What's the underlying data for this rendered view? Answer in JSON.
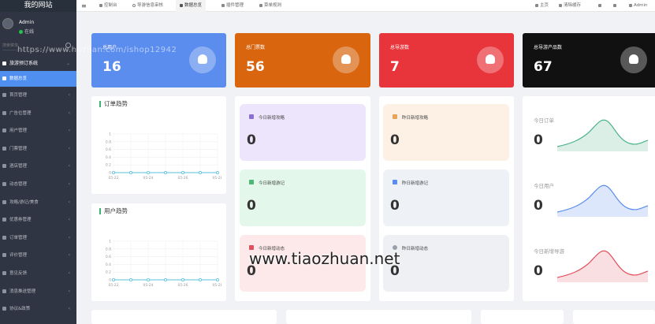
{
  "brand": "我的网站",
  "user": {
    "name": "Admin",
    "status": "在线"
  },
  "search": {
    "placeholder": "搜索菜单"
  },
  "sidebar": {
    "group": "旅游预订系统",
    "items": [
      {
        "label": "数据总览",
        "active": true
      },
      {
        "label": "首页管理"
      },
      {
        "label": "广告位管理"
      },
      {
        "label": "用户管理"
      },
      {
        "label": "门票管理"
      },
      {
        "label": "酒店管理"
      },
      {
        "label": "动态管理"
      },
      {
        "label": "攻略/游记/美食"
      },
      {
        "label": "优惠券管理"
      },
      {
        "label": "订单管理"
      },
      {
        "label": "评价管理"
      },
      {
        "label": "意见反馈"
      },
      {
        "label": "消息推送管理"
      },
      {
        "label": "协议&政策"
      }
    ]
  },
  "topbar": {
    "menu_icon": "≡",
    "tabs": [
      {
        "label": "控制台"
      },
      {
        "label": "导游信息审核"
      },
      {
        "label": "数据总览",
        "active": true
      },
      {
        "label": "插件管理"
      },
      {
        "label": "菜单规则"
      }
    ],
    "right": {
      "home": "主页",
      "clear_cache": "清除缓存",
      "user": "Admin"
    }
  },
  "stats": [
    {
      "label": "总用户",
      "value": "16",
      "color": "#5b8def",
      "icon": "user-icon"
    },
    {
      "label": "总门票数",
      "value": "56",
      "color": "#d9650f",
      "icon": "crown-icon"
    },
    {
      "label": "总导游数",
      "value": "7",
      "color": "#e8343b",
      "icon": "trophy-icon"
    },
    {
      "label": "总导游产品数",
      "value": "67",
      "color": "#111111",
      "icon": "trophy-icon"
    }
  ],
  "order_trend": {
    "title": "订单趋势",
    "chart_data": {
      "type": "line",
      "x": [
        "05-22",
        "05-23",
        "05-24",
        "05-25",
        "05-26",
        "05-27",
        "05-28"
      ],
      "values": [
        0,
        0,
        0,
        0,
        0,
        0,
        0
      ],
      "y_ticks": [
        "0",
        "0.2",
        "0.4",
        "0.6",
        "0.8",
        "1"
      ],
      "x_ticks": [
        "05-22",
        "05-24",
        "05-26",
        "05-28"
      ],
      "ylim": [
        0,
        1
      ]
    }
  },
  "user_trend": {
    "title": "用户趋势",
    "chart_data": {
      "type": "line",
      "x": [
        "05-22",
        "05-23",
        "05-24",
        "05-25",
        "05-26",
        "05-27",
        "05-28"
      ],
      "values": [
        0,
        0,
        0,
        0,
        0,
        0,
        0
      ],
      "y_ticks": [
        "0",
        "0.2",
        "0.4",
        "0.6",
        "0.8",
        "1"
      ],
      "x_ticks": [
        "05-22",
        "05-24",
        "05-26",
        "05-28"
      ],
      "ylim": [
        0,
        1
      ]
    }
  },
  "tiles": [
    {
      "label": "今日新增攻略",
      "value": "0",
      "bg": "#ece5fb",
      "icon_color": "#8d6fd1"
    },
    {
      "label": "昨日新增攻略",
      "value": "0",
      "bg": "#fdf1e6",
      "icon_color": "#e8a45a"
    },
    {
      "label": "今日新增游记",
      "value": "0",
      "bg": "#e3f8ea",
      "icon_color": "#4cb873"
    },
    {
      "label": "昨日新增游记",
      "value": "0",
      "bg": "#eef1f6",
      "icon_color": "#5b8def"
    },
    {
      "label": "今日新增动态",
      "value": "0",
      "bg": "#fde8ea",
      "icon_color": "#e0505e"
    },
    {
      "label": "昨日新增动态",
      "value": "0",
      "bg": "#eff0f3",
      "icon_color": "#9aa0aa"
    }
  ],
  "sparks": [
    {
      "label": "今日订单",
      "value": "0",
      "color": "#4cb38a"
    },
    {
      "label": "今日用户",
      "value": "0",
      "color": "#5b8def"
    },
    {
      "label": "今日新增导游",
      "value": "0",
      "color": "#e0505e"
    }
  ],
  "watermarks": {
    "top": "https://www.huzhan.com/ishop12942",
    "center": "www.tiaozhuan.net"
  }
}
